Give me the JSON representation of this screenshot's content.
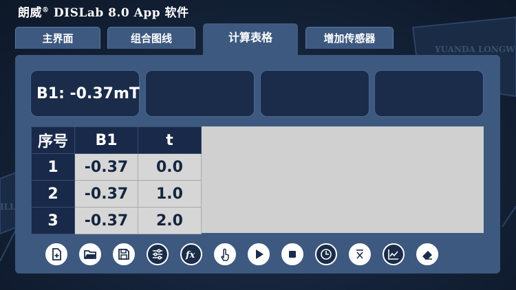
{
  "app": {
    "title_prefix": "朗威",
    "title_mark": "®",
    "title_rest": " DISLab 8.0 App 软件"
  },
  "tabs": [
    {
      "label": "主界面"
    },
    {
      "label": "组合图线"
    },
    {
      "label": "计算表格"
    },
    {
      "label": "增加传感器"
    }
  ],
  "active_tab": "计算表格",
  "readings": [
    {
      "text": "B1: -0.37mT"
    },
    {
      "text": ""
    },
    {
      "text": ""
    },
    {
      "text": ""
    }
  ],
  "table": {
    "headers": [
      "序号",
      "B1",
      "t"
    ],
    "rows": [
      [
        "1",
        "-0.37",
        "0.0"
      ],
      [
        "2",
        "-0.37",
        "1.0"
      ],
      [
        "3",
        "-0.37",
        "2.0"
      ]
    ]
  },
  "toolbar": [
    {
      "icon": "new-file-icon"
    },
    {
      "icon": "open-folder-icon"
    },
    {
      "icon": "save-icon"
    },
    {
      "icon": "settings-sliders-icon"
    },
    {
      "icon": "function-fx-icon"
    },
    {
      "icon": "touch-icon"
    },
    {
      "icon": "play-icon"
    },
    {
      "icon": "stop-icon"
    },
    {
      "icon": "clock-icon"
    },
    {
      "icon": "x-bar-icon"
    },
    {
      "icon": "chart-icon"
    },
    {
      "icon": "eraser-icon"
    }
  ],
  "background": {
    "watermark_1": "YUANDA LONGW",
    "watermark_2": "ILL"
  },
  "colors": {
    "panel": "#3d5980",
    "dark": "#18294a",
    "table_bg": "#d0d0d0"
  }
}
